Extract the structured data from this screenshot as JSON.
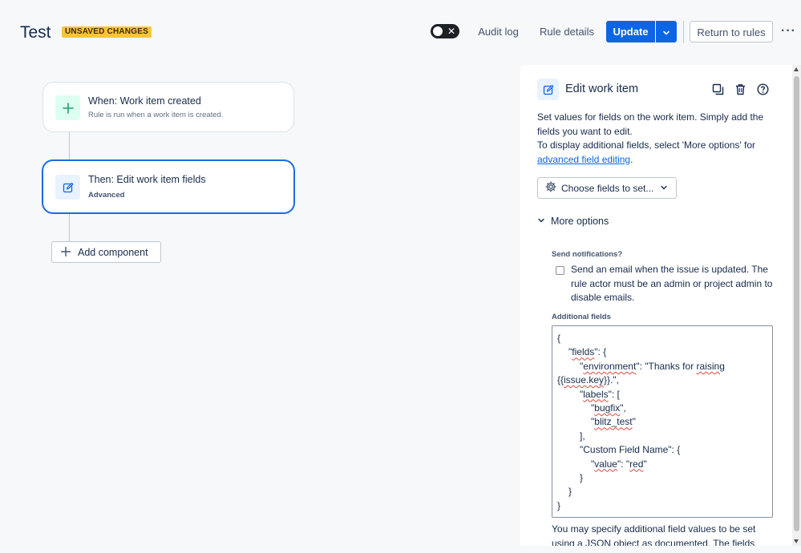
{
  "header": {
    "title": "Test",
    "badge": "UNSAVED CHANGES",
    "toggle_off_glyph": "✕",
    "audit_log": "Audit log",
    "rule_details": "Rule details",
    "update": "Update",
    "return_to_rules": "Return to rules",
    "more": "···"
  },
  "canvas": {
    "trigger": {
      "title": "When: Work item created",
      "subtitle": "Rule is run when a work item is created.",
      "icon": "plus-icon"
    },
    "action": {
      "title": "Then: Edit work item fields",
      "subtitle": "Advanced",
      "icon": "edit-icon"
    },
    "add_component": "Add component"
  },
  "panel": {
    "title": "Edit work item",
    "icons": [
      "duplicate-icon",
      "trash-icon",
      "help-icon"
    ],
    "description_1": "Set values for fields on the work item. Simply add the fields you want to edit.",
    "description_2": "To display additional fields, select 'More options' for",
    "description_link": "advanced field editing",
    "description_end": ".",
    "choose_fields": "Choose fields to set...",
    "more_options": "More options",
    "send_notifications_label": "Send notifications?",
    "send_notifications_text": "Send an email when the issue is updated. The rule actor must be an admin or project admin to disable emails.",
    "send_notifications_checked": false,
    "additional_fields_label": "Additional fields",
    "json": {
      "l1": "{",
      "l2a": "\"",
      "l2b": "fields",
      "l2c": "\": {",
      "l3a": "\"",
      "l3b": "environment",
      "l3c": "\": \"Thanks for ",
      "l3d": "raising",
      "l4a": "{{",
      "l4b": "issue.key",
      "l4c": "}}.\",",
      "l5a": "\"",
      "l5b": "labels",
      "l5c": "\": [",
      "l6a": "\"",
      "l6b": "bugfix",
      "l6c": "\",",
      "l7a": "\"",
      "l7b": "blitz_test",
      "l7c": "\"",
      "l8": "],",
      "l9": "\"Custom Field Name\": {",
      "l10a": "\"",
      "l10b": "value",
      "l10c": "\": \"",
      "l10d": "red",
      "l10e": "\"",
      "l11": "}",
      "l12": "}",
      "l13": "}"
    },
    "help_text": "You may specify additional field values to be set using a JSON object as documented. The fields"
  },
  "colors": {
    "primary": "#0c66e4",
    "badge": "#f8c43a",
    "trigger_icon_bg": "#dcfff1",
    "trigger_icon": "#22a06b",
    "action_border": "#1d6ae5"
  }
}
